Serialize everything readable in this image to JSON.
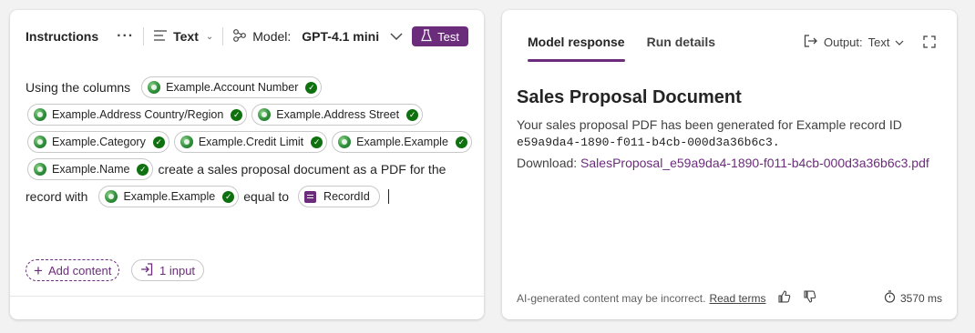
{
  "instructions": {
    "title": "Instructions",
    "more": "···",
    "format_label": "Text",
    "model_prefix": "Model:",
    "model_name": "GPT-4.1 mini",
    "test_label": "Test"
  },
  "prompt": {
    "lead": "Using the columns",
    "chips": [
      "Example.Account Number",
      "Example.Address Country/Region",
      "Example.Address Street",
      "Example.Category",
      "Example.Credit Limit",
      "Example.Example",
      "Example.Name",
      "Example.Example"
    ],
    "middle_1": "create a sales proposal document as a PDF for the",
    "middle_2": "record with",
    "middle_3": "equal to",
    "input_chip": "RecordId"
  },
  "bottom": {
    "add_content": "Add content",
    "inputs": "1 input"
  },
  "response": {
    "tabs": [
      "Model response",
      "Run details"
    ],
    "output_label": "Output:",
    "output_value": "Text",
    "title": "Sales Proposal Document",
    "body_1": "Your sales proposal PDF has been generated for Example record ID",
    "record_id": "e59a9da4-1890-f011-b4cb-000d3a36b6c3.",
    "download_label": "Download:",
    "download_link": "SalesProposal_e59a9da4-1890-f011-b4cb-000d3a36b6c3.pdf",
    "disclaimer": "AI-generated content may be incorrect.",
    "read_terms": "Read terms",
    "elapsed": "3570 ms"
  },
  "colors": {
    "accent": "#6b2d7b",
    "success": "#0e700e"
  }
}
